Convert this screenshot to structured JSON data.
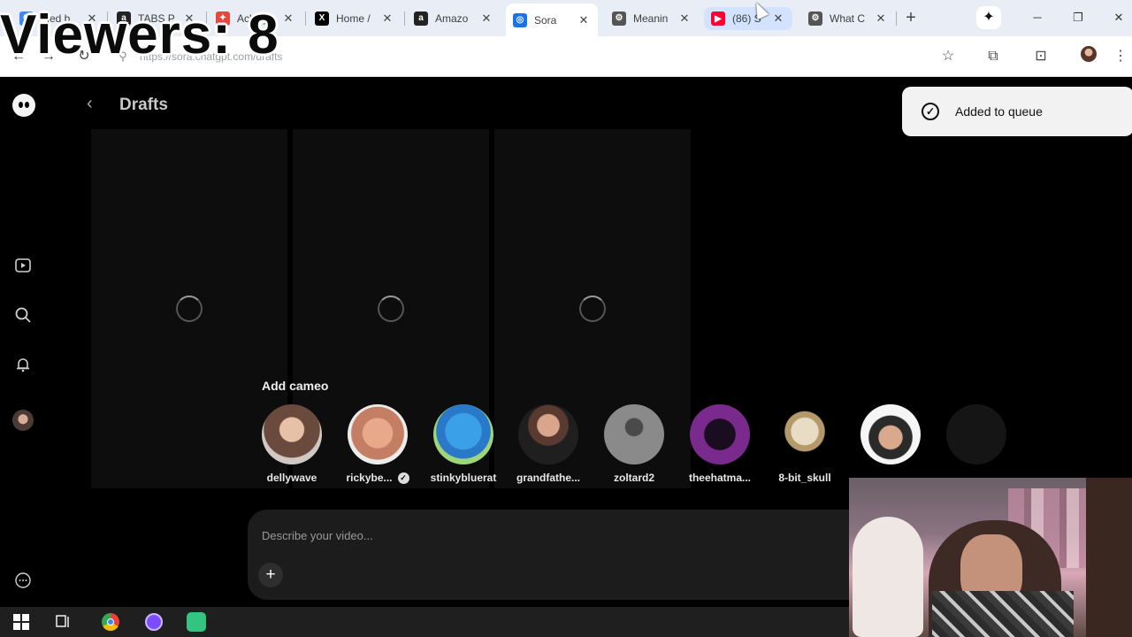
{
  "overlay": {
    "viewers": "Viewers: 8"
  },
  "browser": {
    "tabs": [
      {
        "label": "Med b",
        "icon": "google-icon",
        "color": "#4285f4",
        "glyph": "G"
      },
      {
        "label": "TABS P",
        "icon": "amazon-icon",
        "color": "#222222",
        "glyph": "a"
      },
      {
        "label": "Ackley",
        "icon": "flame-icon",
        "color": "#e8453c",
        "glyph": "✦"
      },
      {
        "label": "Home /",
        "icon": "x-icon",
        "color": "#000000",
        "glyph": "X"
      },
      {
        "label": "Amazo",
        "icon": "amazon-icon",
        "color": "#222222",
        "glyph": "a"
      },
      {
        "label": "Sora",
        "icon": "sora-icon",
        "color": "#1a73e8",
        "glyph": "◎"
      },
      {
        "label": "Meanin",
        "icon": "openai-icon",
        "color": "#555555",
        "glyph": "⚙"
      },
      {
        "label": "(86) S",
        "icon": "youtube-icon",
        "color": "#ff0033",
        "glyph": "▶"
      },
      {
        "label": "What C",
        "icon": "openai-icon",
        "color": "#555555",
        "glyph": "⚙"
      }
    ],
    "url": "https://sora.chatgpt.com/drafts"
  },
  "page": {
    "title": "Drafts",
    "toast": "Added to queue",
    "cameo_title": "Add cameo",
    "cameos": [
      {
        "name": "dellywave"
      },
      {
        "name": "rickybe...",
        "verified": true
      },
      {
        "name": "stinkybluerat"
      },
      {
        "name": "grandfathe..."
      },
      {
        "name": "zoltard2"
      },
      {
        "name": "theehatma..."
      },
      {
        "name": "8-bit_skull"
      },
      {
        "name": ""
      }
    ],
    "prompt_placeholder": "Describe your video..."
  }
}
